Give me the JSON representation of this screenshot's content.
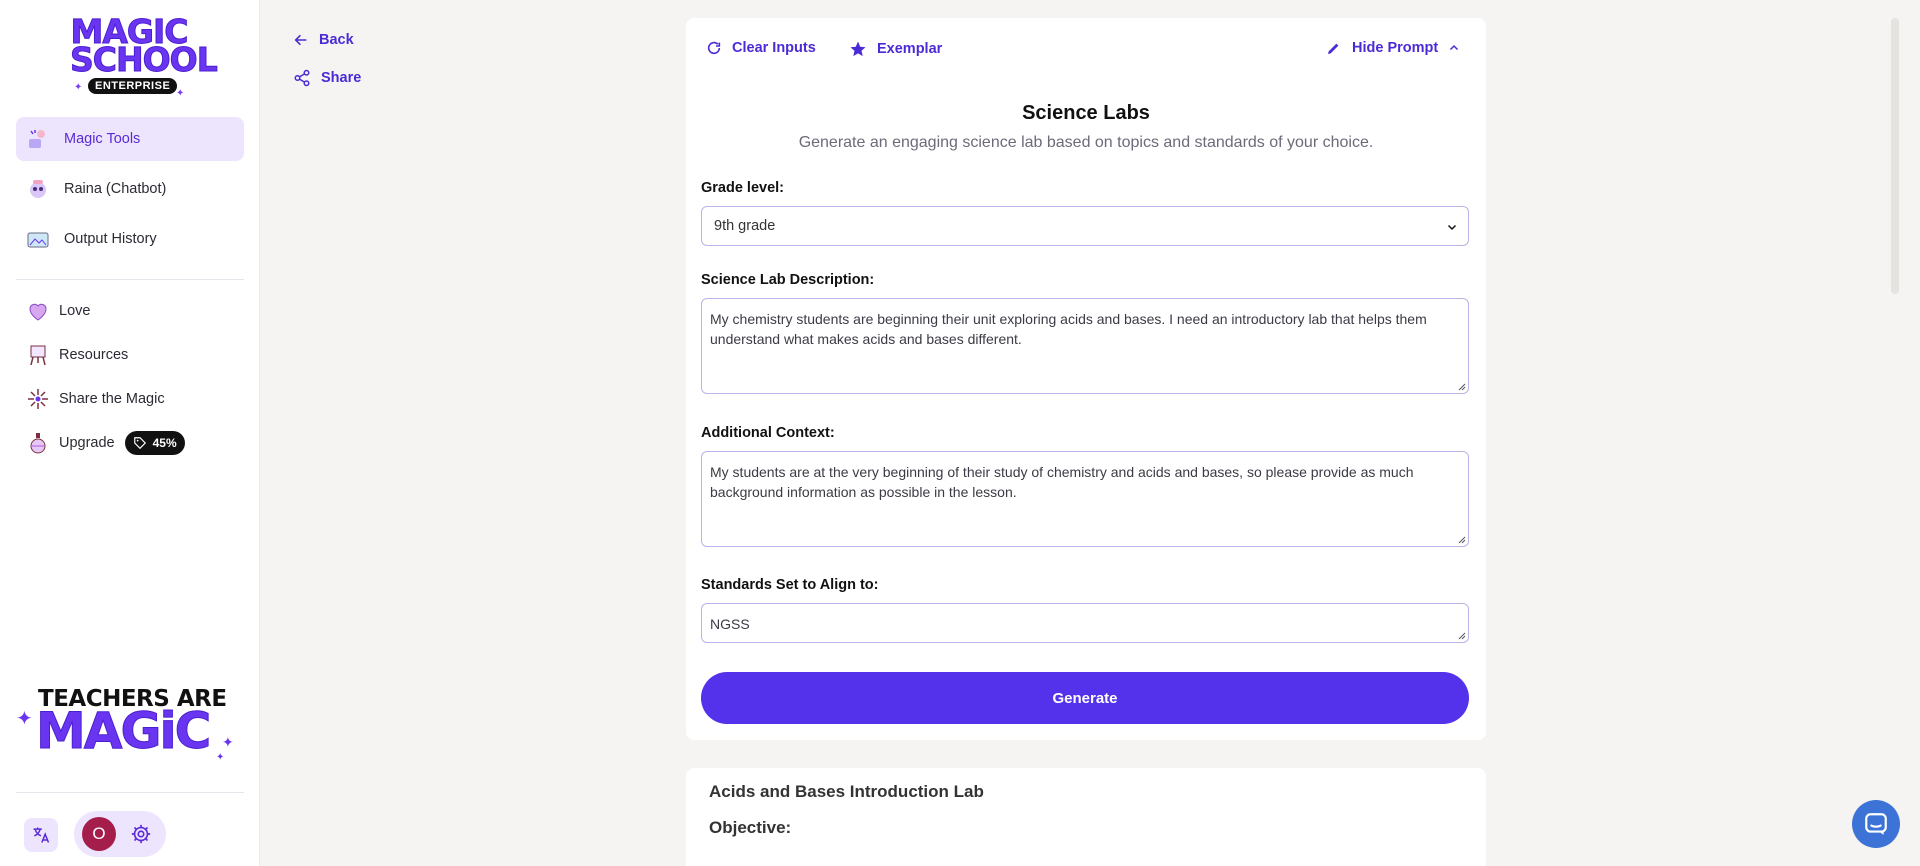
{
  "logo": {
    "line1": "MAGIC",
    "line2": "SCHOOL",
    "badge": "ENTERPRISE"
  },
  "sidebar": {
    "primary": [
      {
        "label": "Magic Tools",
        "icon": "magic-tools-icon",
        "active": true
      },
      {
        "label": "Raina (Chatbot)",
        "icon": "robot-icon",
        "active": false
      },
      {
        "label": "Output History",
        "icon": "history-icon",
        "active": false
      }
    ],
    "secondary": [
      {
        "label": "Love",
        "icon": "heart-icon"
      },
      {
        "label": "Resources",
        "icon": "easel-icon"
      },
      {
        "label": "Share the Magic",
        "icon": "sparkle-icon"
      },
      {
        "label": "Upgrade",
        "icon": "potion-icon",
        "badge": "45%"
      }
    ],
    "promo": {
      "line1": "TEACHERS ARE",
      "line2": "MAGiC"
    },
    "user": {
      "initial": "O"
    }
  },
  "top_links": {
    "back": "Back",
    "share": "Share"
  },
  "toolbar": {
    "clear": "Clear Inputs",
    "exemplar": "Exemplar",
    "hide_prompt": "Hide Prompt"
  },
  "tool": {
    "title": "Science Labs",
    "subtitle": "Generate an engaging science lab based on topics and standards of your choice."
  },
  "form": {
    "grade_label": "Grade level:",
    "grade_value": "9th grade",
    "description_label": "Science Lab Description:",
    "description_value": "My chemistry students are beginning their unit exploring acids and bases. I need an introductory lab that helps them understand what makes acids and bases different.",
    "context_label": "Additional Context:",
    "context_value": "My students are at the very beginning of their study of chemistry and acids and bases, so please provide as much background information as possible in the lesson.",
    "standards_label": "Standards Set to Align to:",
    "standards_value": "NGSS",
    "generate_label": "Generate"
  },
  "output": {
    "title": "Acids and Bases Introduction Lab",
    "section": "Objective:"
  },
  "colors": {
    "accent": "#5431ea",
    "active_bg": "#ede4fd",
    "chat": "#3d72d6"
  }
}
